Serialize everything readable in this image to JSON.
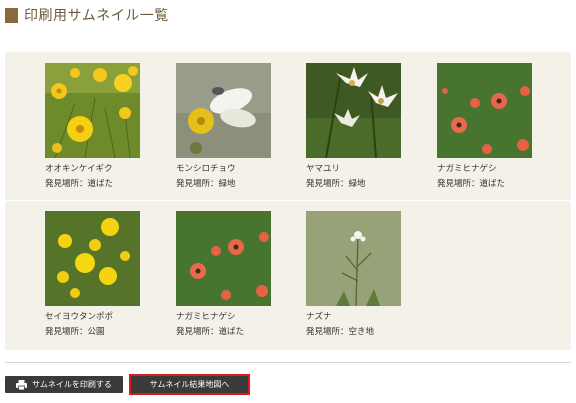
{
  "header": {
    "title": "印刷用サムネイル一覧"
  },
  "items": [
    {
      "name": "オオキンケイギク",
      "place": "発見場所：道ばた",
      "photo": "yellow-coreopsis"
    },
    {
      "name": "モンシロチョウ",
      "place": "発見場所：緑地",
      "photo": "white-butterfly"
    },
    {
      "name": "ヤマユリ",
      "place": "発見場所：緑地",
      "photo": "white-lily"
    },
    {
      "name": "ナガミヒナゲシ",
      "place": "発見場所：道ばた",
      "photo": "orange-poppy"
    },
    {
      "name": "セイヨウタンポポ",
      "place": "発見場所：公園",
      "photo": "dandelion"
    },
    {
      "name": "ナガミヒナゲシ",
      "place": "発見場所：道ばた",
      "photo": "orange-poppy"
    },
    {
      "name": "ナズナ",
      "place": "発見場所：空き地",
      "photo": "shepherds-purse"
    }
  ],
  "buttons": {
    "print_label": "サムネイルを印刷する",
    "map_label": "サムネイル結果地図へ"
  },
  "colors": {
    "accent": "#8a6a3d",
    "button": "#3a3a3a",
    "highlight": "#d81b1b"
  }
}
